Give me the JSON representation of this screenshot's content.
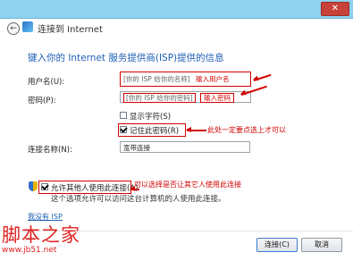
{
  "window": {
    "close_glyph": "✕"
  },
  "nav": {
    "back_glyph": "←",
    "title": "连接到 Internet"
  },
  "heading": "键入你的 Internet 服务提供商(ISP)提供的信息",
  "username": {
    "label": "用户名(U):",
    "placeholder": "[你的 ISP 给你的名称]",
    "hint": "输入用户名"
  },
  "password": {
    "label": "密码(P):",
    "placeholder": "[你的 ISP 给你的密码]",
    "hint": "输入密码"
  },
  "show_chars": {
    "label": "显示字符(S)",
    "checked": false
  },
  "remember_password": {
    "label": "记住此密码(R)",
    "checked": true,
    "annotation": "此处一定要点选上才可以"
  },
  "connection_name": {
    "label": "连接名称(N):",
    "value": "宽带连接"
  },
  "allow_others": {
    "label": "允许其他人使用此连接(A)",
    "checked": true,
    "annotation": "可以选择是否让其它人使用此连接",
    "description": "这个选项允许可以访问这台计算机的人使用此连接。"
  },
  "no_isp_link": "我没有 ISP",
  "buttons": {
    "connect": "连接(C)",
    "cancel": "取消"
  },
  "watermark": {
    "text": "脚本之家",
    "url": "www.jb51.net"
  },
  "colors": {
    "title_bar": "#8fd1ee",
    "heading": "#1f5fb5",
    "annotation_red": "#d10000",
    "close_button": "#c7433a"
  }
}
